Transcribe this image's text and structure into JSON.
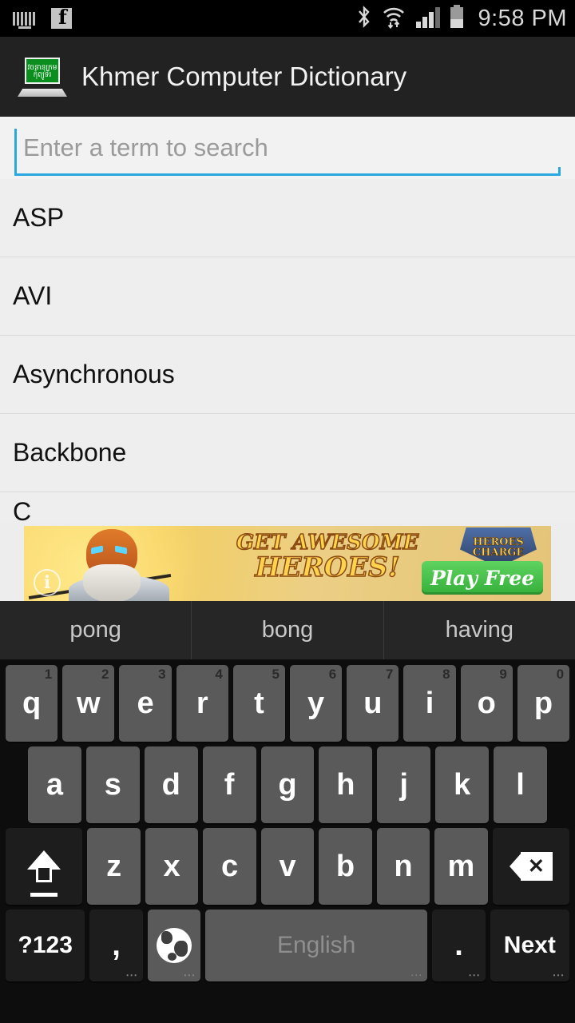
{
  "statusbar": {
    "icons": [
      "keyboard-icon",
      "facebook-icon",
      "bluetooth-icon",
      "wifi-icon",
      "signal-icon",
      "battery-icon"
    ],
    "time": "9:58 PM"
  },
  "titlebar": {
    "app_title": "Khmer Computer Dictionary",
    "logo_line1": "វចនានុក្រម",
    "logo_line2": "កុំព្យូទ័រ"
  },
  "search": {
    "value": "",
    "placeholder": "Enter a term to search"
  },
  "list": {
    "items": [
      {
        "label": "ASP"
      },
      {
        "label": "AVI"
      },
      {
        "label": "Asynchronous"
      },
      {
        "label": "Backbone"
      },
      {
        "label": "C"
      }
    ]
  },
  "ad": {
    "headline_line1": "GET AWESOME",
    "headline_line2": "HEROES!",
    "cta": "Play Free",
    "brand_line1": "HEROES",
    "brand_line2": "CHARGE",
    "info_badge": "i"
  },
  "keyboard": {
    "suggestions": [
      "pong",
      "bong",
      "having"
    ],
    "row1": [
      {
        "key": "q",
        "num": "1"
      },
      {
        "key": "w",
        "num": "2"
      },
      {
        "key": "e",
        "num": "3"
      },
      {
        "key": "r",
        "num": "4"
      },
      {
        "key": "t",
        "num": "5"
      },
      {
        "key": "y",
        "num": "6"
      },
      {
        "key": "u",
        "num": "7"
      },
      {
        "key": "i",
        "num": "8"
      },
      {
        "key": "o",
        "num": "9"
      },
      {
        "key": "p",
        "num": "0"
      }
    ],
    "row2": [
      "a",
      "s",
      "d",
      "f",
      "g",
      "h",
      "j",
      "k",
      "l"
    ],
    "row3": [
      "z",
      "x",
      "c",
      "v",
      "b",
      "n",
      "m"
    ],
    "shift_label": "shift-icon",
    "backspace_label": "backspace-icon",
    "row4": {
      "symbols": "?123",
      "comma": ",",
      "globe": "globe-icon",
      "space": "English",
      "period": ".",
      "next": "Next"
    }
  },
  "colors": {
    "accent": "#29a7df",
    "statusbar_bg": "#000000",
    "titlebar_bg": "#222222",
    "list_bg": "#eeeeee",
    "keyboard_bg": "#0d0d0d",
    "key_bg": "#5a5a5a",
    "key_dark_bg": "#1d1d1d"
  }
}
